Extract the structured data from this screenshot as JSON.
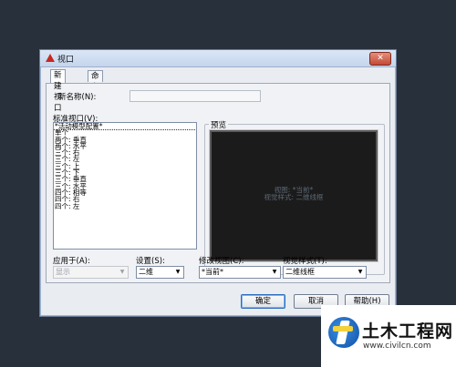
{
  "dialog": {
    "title": "视口",
    "close_glyph": "✕",
    "tabs": [
      {
        "label": "新建视口",
        "active": true
      },
      {
        "label": "命名视口",
        "active": false
      }
    ],
    "new_name_label": "新名称(N):",
    "new_name_value": "",
    "standard_viewports_label": "标准视口(V):",
    "standard_viewports": [
      "*活动模型配置*",
      "单个",
      "两个: 垂直",
      "两个: 水平",
      "三个: 右",
      "三个: 左",
      "三个: 上",
      "三个: 下",
      "三个: 垂直",
      "三个: 水平",
      "四个: 相等",
      "四个: 右",
      "四个: 左"
    ],
    "preview_label": "预览",
    "preview_line1": "视图: *当前*",
    "preview_line2": "视觉样式: 二维线框",
    "apply_to_label": "应用于(A):",
    "apply_to_value": "显示",
    "setup_label": "设置(S):",
    "setup_value": "二维",
    "change_view_label": "修改视图(C):",
    "change_view_value": "*当前*",
    "visual_style_label": "视觉样式(T):",
    "visual_style_value": "二维线框",
    "ok_label": "确定",
    "cancel_label": "取消",
    "help_label": "帮助(H)"
  },
  "watermark": {
    "title": "土木工程网",
    "url": "www.civilcn.com"
  }
}
